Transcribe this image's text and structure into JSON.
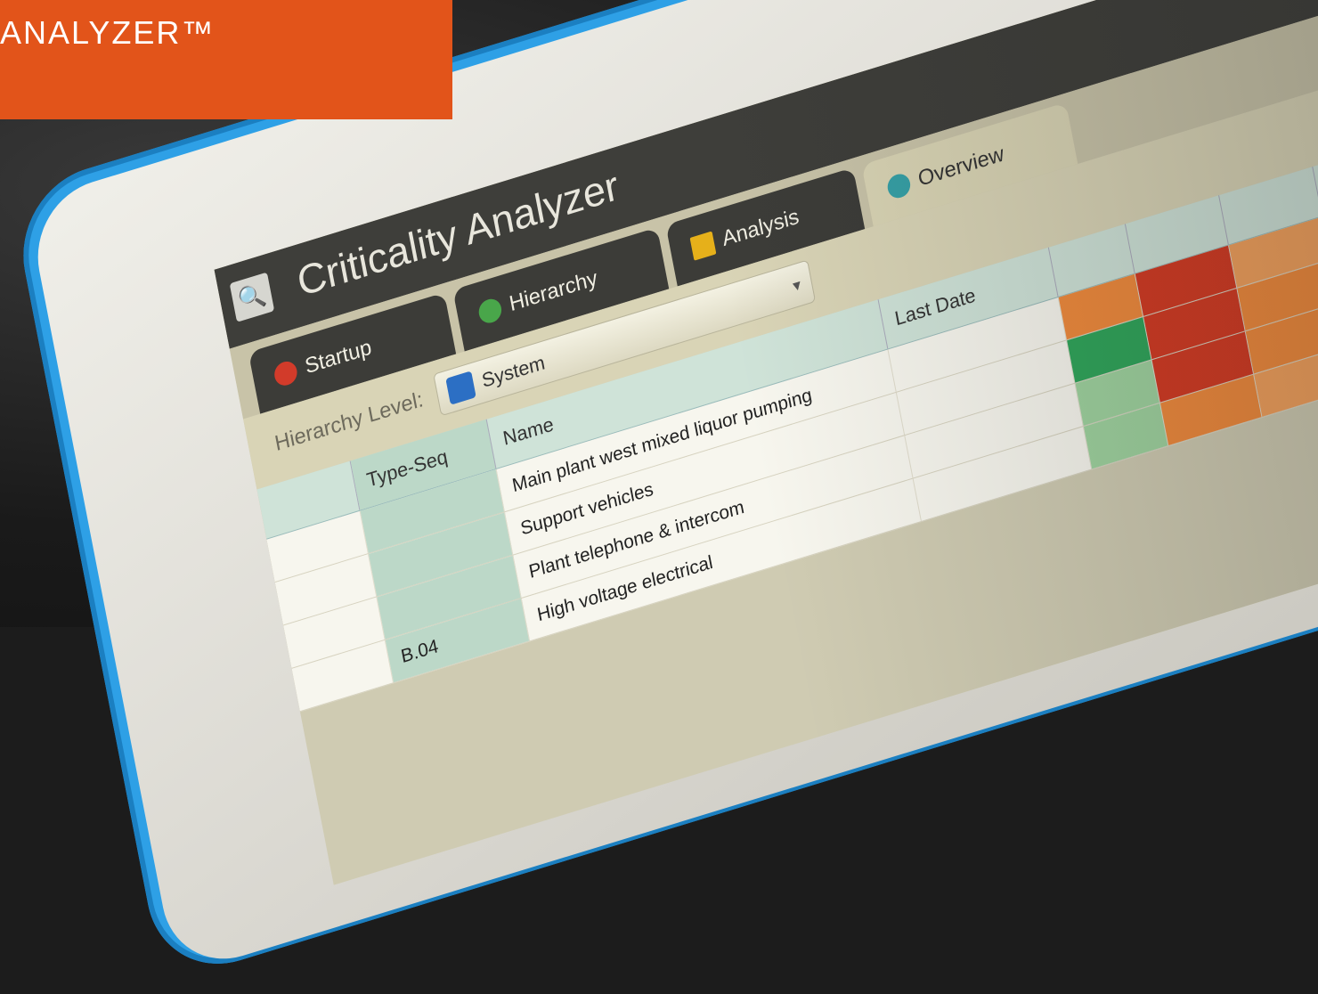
{
  "banner": {
    "text": "ANALYZER™"
  },
  "app": {
    "title": "Criticality Analyzer",
    "tabs": [
      {
        "label": "Startup",
        "color": "#d23b2a"
      },
      {
        "label": "Hierarchy",
        "color": "#49a64a"
      },
      {
        "label": "Analysis",
        "color": "#e6b01a"
      },
      {
        "label": "Overview",
        "color": "#35a0a6"
      }
    ],
    "filter": {
      "label": "Hierarchy Level:",
      "value": "System"
    },
    "grid": {
      "headers": [
        "",
        "Type-Seq",
        "Name",
        "Last Date",
        "",
        "",
        "",
        ""
      ],
      "rows": [
        {
          "seq": "",
          "name": "Main plant west mixed liquor pumping",
          "date": "",
          "colors": [
            "#f08a3c",
            "#d33a22",
            "#f3a15c",
            "#f7f4e6"
          ]
        },
        {
          "seq": "",
          "name": "Support vehicles",
          "date": "",
          "colors": [
            "#2fa55a",
            "#d33a22",
            "#f08a3c",
            "#f7f4e6"
          ]
        },
        {
          "seq": "",
          "name": "Plant telephone & intercom",
          "date": "",
          "colors": [
            "#9fd39f",
            "#d33a22",
            "#f08a3c",
            "#f7f4e6"
          ]
        },
        {
          "seq": "B.04",
          "name": "High voltage electrical",
          "date": "",
          "colors": [
            "#9fd39f",
            "#f08a3c",
            "#f3a15c",
            "#eadf5a"
          ]
        }
      ]
    }
  }
}
